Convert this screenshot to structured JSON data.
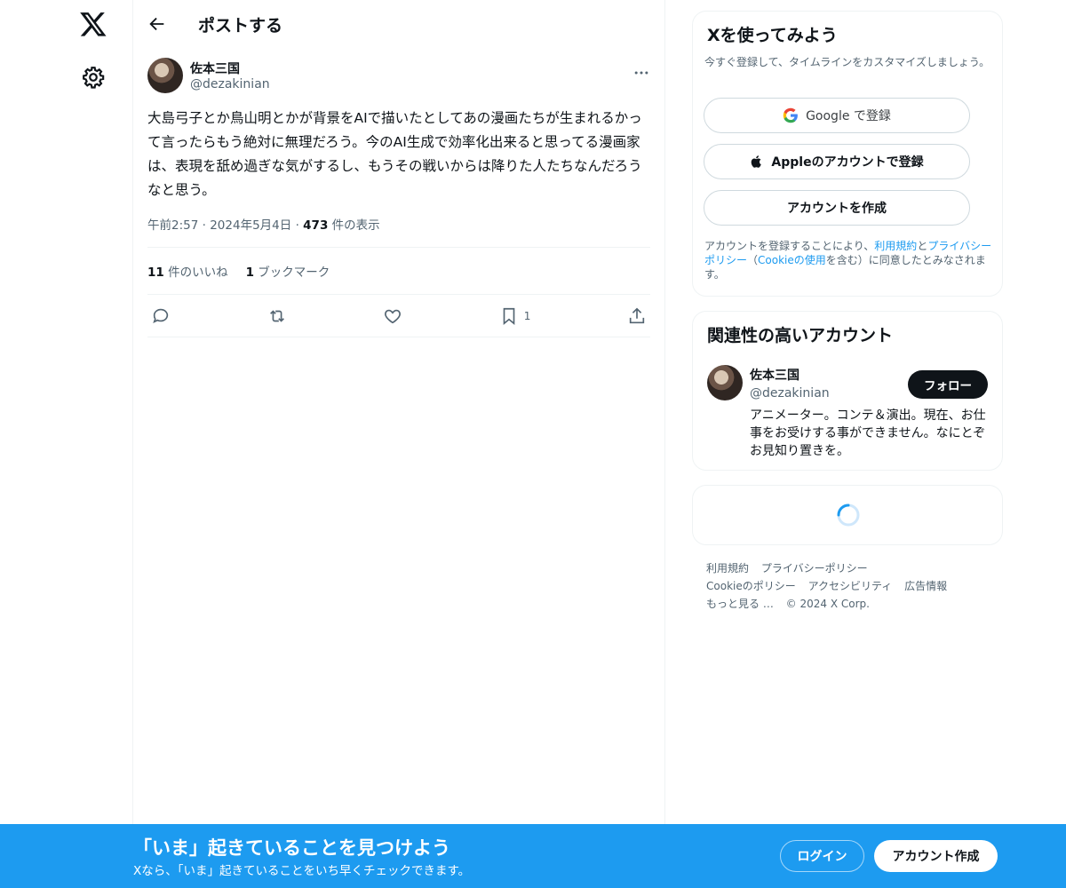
{
  "header": {
    "title": "ポストする"
  },
  "tweet": {
    "author_name": "佐本三国",
    "author_handle": "@dezakinian",
    "text": "大島弓子とか鳥山明とかが背景をAIで描いたとしてあの漫画たちが生まれるかって言ったらもう絶対に無理だろう。今のAI生成で効率化出来ると思ってる漫画家は、表現を舐め過ぎな気がするし、もうその戦いからは降りた人たちなんだろうなと思う。",
    "time": "午前2:57",
    "date": "2024年5月4日",
    "views_count": "473",
    "views_label": "件の表示",
    "likes_count": "11",
    "likes_label": "件のいいね",
    "bookmarks_count": "1",
    "bookmarks_label": "ブックマーク",
    "bookmark_action_count": "1"
  },
  "signup": {
    "title": "Xを使ってみよう",
    "subtitle": "今すぐ登録して、タイムラインをカスタマイズしましょう。",
    "google_label": "Google で登録",
    "apple_label": "Appleのアカウントで登録",
    "create_label": "アカウントを作成",
    "terms_pre": "アカウントを登録することにより、",
    "terms_link1": "利用規約",
    "terms_mid": "と",
    "terms_link2": "プライバシーポリシー",
    "terms_mid2": "（",
    "terms_link3": "Cookieの使用",
    "terms_post": "を含む）に同意したとみなされます。"
  },
  "related": {
    "title": "関連性の高いアカウント",
    "name": "佐本三国",
    "handle": "@dezakinian",
    "follow_label": "フォロー",
    "bio": "アニメーター。コンテ＆演出。現在、お仕事をお受けする事ができません。なにとぞお見知り置きを。"
  },
  "footer": {
    "links": [
      "利用規約",
      "プライバシーポリシー",
      "Cookieのポリシー",
      "アクセシビリティ",
      "広告情報",
      "もっと見る …",
      "© 2024 X Corp."
    ]
  },
  "banner": {
    "title": "「いま」起きていることを見つけよう",
    "subtitle": "Xなら、「いま」起きていることをいち早くチェックできます。",
    "login_label": "ログイン",
    "signup_label": "アカウント作成"
  },
  "colors": {
    "accent": "#1d9bf0",
    "text": "#0f1419",
    "muted": "#536471"
  }
}
